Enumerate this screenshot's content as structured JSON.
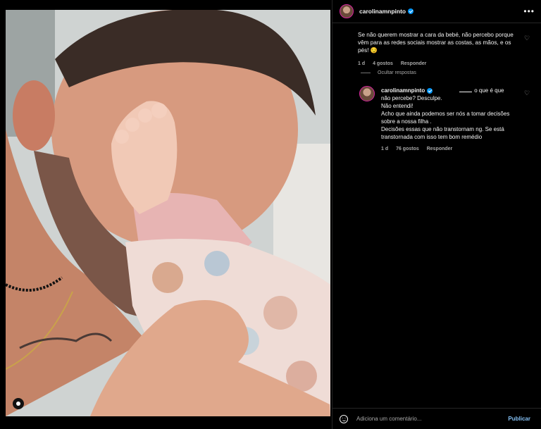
{
  "post": {
    "username": "carolinamnpinto"
  },
  "comments": [
    {
      "text": "Se não querem mostrar a cara da bebé, não percebo porque vêm para as redes sociais mostrar as costas, as mãos, e os pés! 😏",
      "time": "1 d",
      "likes": "4 gostos",
      "reply_label": "Responder"
    }
  ],
  "hide_replies_label": "Ocultar respostas",
  "reply": {
    "username": "carolinamnpinto",
    "mention_suffix": "o que é que não percebe? Desculpe.",
    "line2": "Não entendi!",
    "line3": "Acho que ainda podemos ser nós a tomar decisões sobre a nossa filha .",
    "line4": "Decisões essas que não transtornam ng. Se está transtornada com isso tem bom remédio",
    "time": "1 d",
    "likes": "76 gostos",
    "reply_label": "Responder"
  },
  "footer": {
    "placeholder": "Adiciona um comentário...",
    "publish_label": "Publicar"
  },
  "icons": {
    "more": "more-horizontal-icon",
    "heart": "heart-icon",
    "emoji": "emoji-icon",
    "user_tag": "user-tag-icon",
    "verified": "verified-badge-icon"
  },
  "colors": {
    "background": "#000000",
    "verified": "#0095f6",
    "publish": "#85c1f5",
    "secondary_text": "#a8a8a8"
  }
}
